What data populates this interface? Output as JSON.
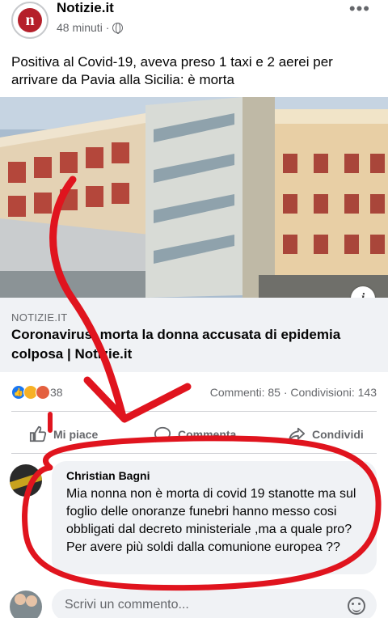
{
  "header": {
    "page_name": "Notizie.it",
    "avatar_letter": "n",
    "time": "48 minuti ·",
    "more": "•••"
  },
  "post": {
    "text": "Positiva al Covid-19, aveva preso 1 taxi e 2 aerei per arrivare da Pavia alla Sicilia: è morta"
  },
  "link": {
    "info": "i",
    "domain": "NOTIZIE.IT",
    "title": "Coronavirus, morta la donna accusata di epidemia colposa | Notizie.it"
  },
  "stats": {
    "reaction_count": "38",
    "comments_shares": "Commenti: 85 · Condivisioni: 143"
  },
  "actions": {
    "like": "Mi piace",
    "comment": "Commenta",
    "share": "Condividi"
  },
  "comment": {
    "author": "Christian Bagni",
    "text": "Mia nonna non è morta di covid 19 stanotte ma sul foglio delle onoranze funebri hanno messo cosi obbligati dal decreto ministeriale  ,ma a quale pro? Per avere più soldi dalla comunione europea ??"
  },
  "composer": {
    "placeholder": "Scrivi un commento..."
  },
  "colors": {
    "annotation_red": "#e0141e",
    "facebook_blue": "#1877f2"
  },
  "icons": [
    "globe-icon",
    "more-icon",
    "info-icon",
    "like-icon",
    "comment-icon",
    "share-icon",
    "emoji-icon"
  ]
}
